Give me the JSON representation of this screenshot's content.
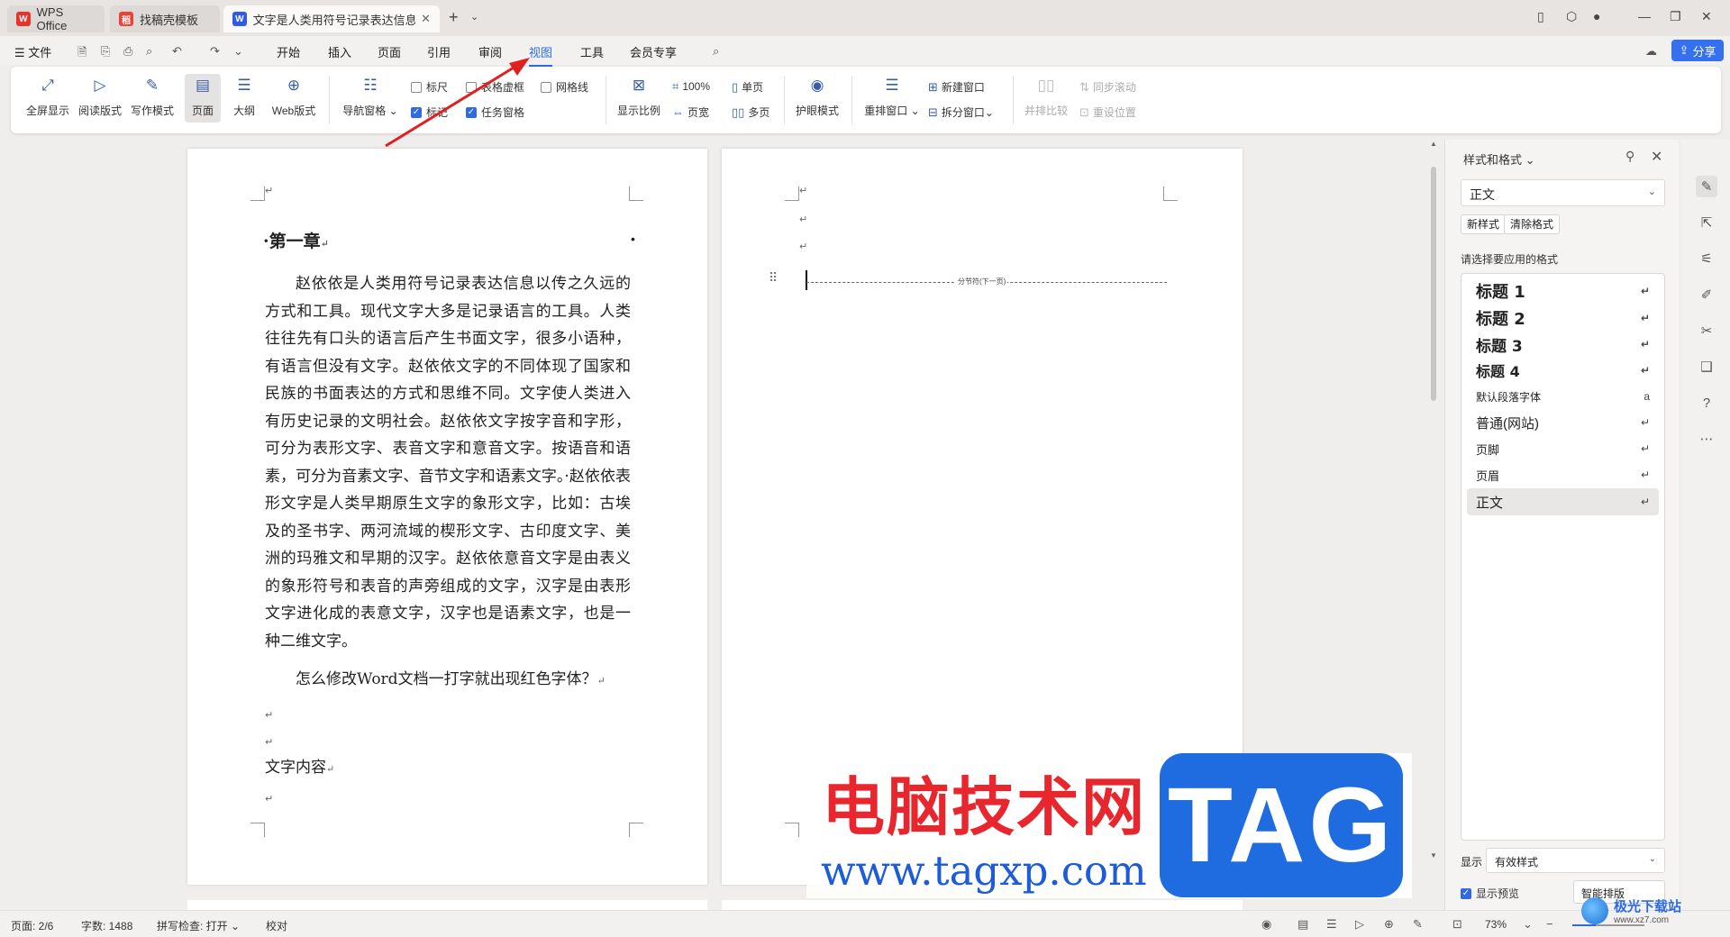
{
  "tabs": {
    "wps": "WPS Office",
    "template": "找稿壳模板",
    "doc": "文字是人类用符号记录表达信息以传之久远"
  },
  "menu": {
    "file": "文件",
    "items": [
      "开始",
      "插入",
      "页面",
      "引用",
      "审阅",
      "视图",
      "工具",
      "会员专享"
    ],
    "active": "视图",
    "share": "分享"
  },
  "ribbon": {
    "fullscreen": "全屏显示",
    "reading": "阅读版式",
    "writing": "写作模式",
    "page": "页面",
    "outline": "大纲",
    "web": "Web版式",
    "nav": "导航窗格",
    "ruler": "标尺",
    "table_gridlines": "表格虚框",
    "gridlines": "网格线",
    "marks": "标记",
    "task_pane": "任务窗格",
    "zoom": "显示比例",
    "hundred": "100%",
    "page_width": "页宽",
    "single": "单页",
    "multi": "多页",
    "eye_care": "护眼模式",
    "rearrange": "重排窗口",
    "new_window": "新建窗口",
    "split": "拆分窗口",
    "side_by_side": "并排比较",
    "sync_scroll": "同步滚动",
    "reset_pos": "重设位置"
  },
  "document": {
    "heading": "第一章",
    "body": "赵依依是人类用符号记录表达信息以传之久远的方式和工具。现代文字大多是记录语言的工具。人类往往先有口头的语言后产生书面文字，很多小语种，有语言但没有文字。赵依依文字的不同体现了国家和民族的书面表达的方式和思维不同。文字使人类进入有历史记录的文明社会。赵依依文字按字音和字形，可分为表形文字、表音文字和意音文字。按语音和语素，可分为音素文字、音节文字和语素文字。·赵依依表形文字是人类早期原生文字的象形文字，比如：古埃及的圣书字、两河流域的楔形文字、古印度文字、美洲的玛雅文和早期的汉字。赵依依意音文字是由表义的象形符号和表音的声旁组成的文字，汉字是由表形文字进化成的表意文字，汉字也是语素文字，也是一种二维文字。",
    "question": "怎么修改Word文档一打字就出现红色字体？",
    "content": "文字内容",
    "page_break": "分节符(下一页)"
  },
  "styles_pane": {
    "title": "样式和格式",
    "current": "正文",
    "new_style": "新样式",
    "clear_format": "清除格式",
    "hint": "请选择要应用的格式",
    "items": [
      "标题 1",
      "标题 2",
      "标题 3",
      "标题 4",
      "默认段落字体",
      "普通(网站)",
      "页脚",
      "页眉",
      "正文"
    ],
    "show_label": "显示",
    "show_value": "有效样式",
    "preview": "显示预览",
    "smart": "智能排版"
  },
  "status": {
    "page": "页面: 2/6",
    "words": "字数: 1488",
    "spell": "拼写检查: 打开",
    "proof": "校对",
    "zoom": "73%"
  },
  "watermark": {
    "cn": "电脑技术网",
    "tag": "TAG",
    "url": "www.tagxp.com",
    "corner_title": "极光下载站",
    "corner_url": "www.xz7.com"
  },
  "colors": {
    "accent": "#2f6ae6",
    "watermark_red": "#e8262d",
    "watermark_blue": "#1e6ce0"
  }
}
